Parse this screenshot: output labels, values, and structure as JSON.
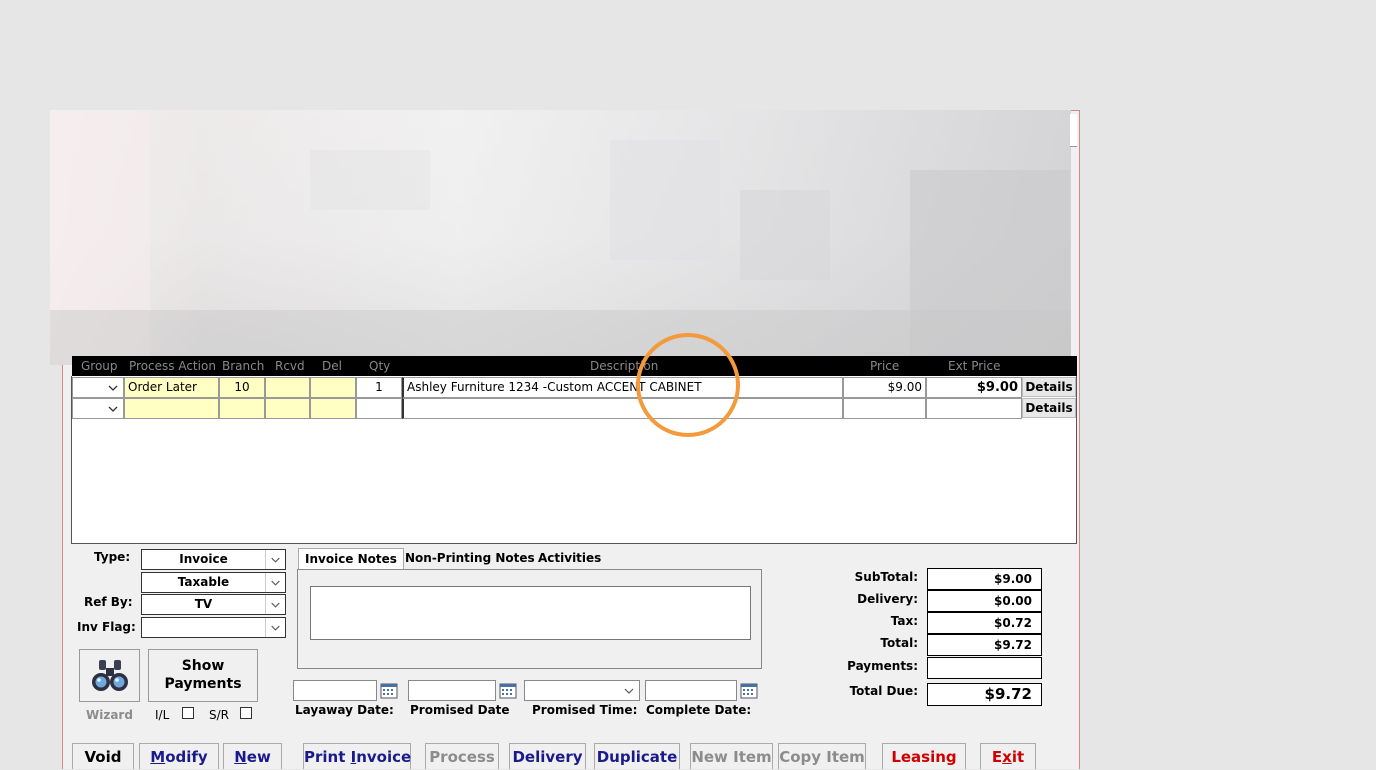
{
  "grid": {
    "headers": [
      "Group",
      "Process Action",
      "Branch",
      "Rcvd",
      "Del",
      "Qty",
      "Description",
      "Price",
      "Ext Price"
    ],
    "rows": [
      {
        "group": "",
        "action": "Order Later",
        "branch": "10",
        "rcvd": "",
        "del": "",
        "qty": "1",
        "description": "Ashley Furniture 1234 -Custom ACCENT CABINET",
        "price": "$9.00",
        "ext_price": "$9.00",
        "details": "Details"
      },
      {
        "group": "",
        "action": "",
        "branch": "",
        "rcvd": "",
        "del": "",
        "qty": "",
        "description": "",
        "price": "",
        "ext_price": "",
        "details": "Details"
      }
    ]
  },
  "form": {
    "type_label": "Type:",
    "type_value": "Invoice",
    "tax_value": "Taxable",
    "refby_label": "Ref By:",
    "refby_value": "TV",
    "invflag_label": "Inv Flag:",
    "invflag_value": "",
    "wizard_label": "Wizard",
    "show_payments_line1": "Show",
    "show_payments_line2": "Payments",
    "il_label": "I/L",
    "sr_label": "S/R"
  },
  "tabs": [
    "Invoice Notes",
    "Non-Printing Notes",
    "Activities"
  ],
  "dates": {
    "layaway_label": "Layaway Date:",
    "promised_label": "Promised Date",
    "promised_time_label": "Promised Time:",
    "complete_label": "Complete Date:"
  },
  "totals": {
    "subtotal_label": "SubTotal:",
    "subtotal": "$9.00",
    "delivery_label": "Delivery:",
    "delivery": "$0.00",
    "tax_label": "Tax:",
    "tax": "$0.72",
    "total_label": "Total:",
    "total": "$9.72",
    "payments_label": "Payments:",
    "payments": "",
    "total_due_label": "Total Due:",
    "total_due": "$9.72"
  },
  "buttons": {
    "void": "Void",
    "modify_u": "M",
    "modify_rest": "odify",
    "new_u": "N",
    "new_rest": "ew",
    "print_pre": "Print ",
    "print_u": "I",
    "print_rest": "nvoice",
    "process": "Process",
    "delivery": "Delivery",
    "duplicate": "Duplicate",
    "new_item": "New Item",
    "copy_item": "Copy Item",
    "leasing": "Leasing",
    "exit_pre": "E",
    "exit_u": "x",
    "exit_rest": "it"
  },
  "colors": {
    "accent_blue": "#1a1a8c",
    "disabled": "#8c8c8c",
    "red": "#d00000",
    "highlight_ring": "#f39a3b",
    "yellow_cell": "#ffffc4"
  }
}
